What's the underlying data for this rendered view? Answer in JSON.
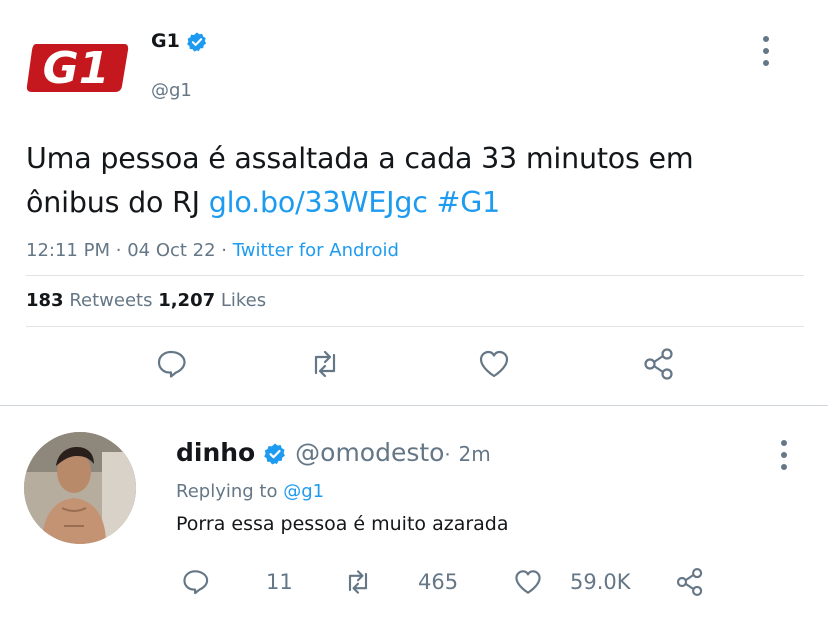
{
  "tweet": {
    "name": "G1",
    "handle": "@g1",
    "text_plain": "Uma pessoa é assaltada a cada 33 minutos em\nônibus do RJ ",
    "link": "glo.bo/33WEJgc",
    "hashtag": "#G1",
    "time": "12:11 PM",
    "date": "04 Oct 22",
    "source": "Twitter for Android",
    "dot": "·",
    "retweets_count": "183",
    "retweets_label": "Retweets",
    "likes_count": "1,207",
    "likes_label": "Likes"
  },
  "reply": {
    "name": "dinho",
    "handle": "@omodesto",
    "time": "2m",
    "dot": "·",
    "replying_prefix": "Replying to",
    "replying_handle": "@g1",
    "text": "Porra essa pessoa é muito azarada",
    "replies": "11",
    "retweets": "465",
    "likes": "59.0K"
  },
  "colors": {
    "brand_red": "#c4171e",
    "verified_blue": "#1d9bf0",
    "muted": "#657786"
  },
  "icons": [
    "g1-logo",
    "verified-badge-icon",
    "more-vertical-icon",
    "reply-icon",
    "retweet-icon",
    "like-icon",
    "share-icon"
  ]
}
